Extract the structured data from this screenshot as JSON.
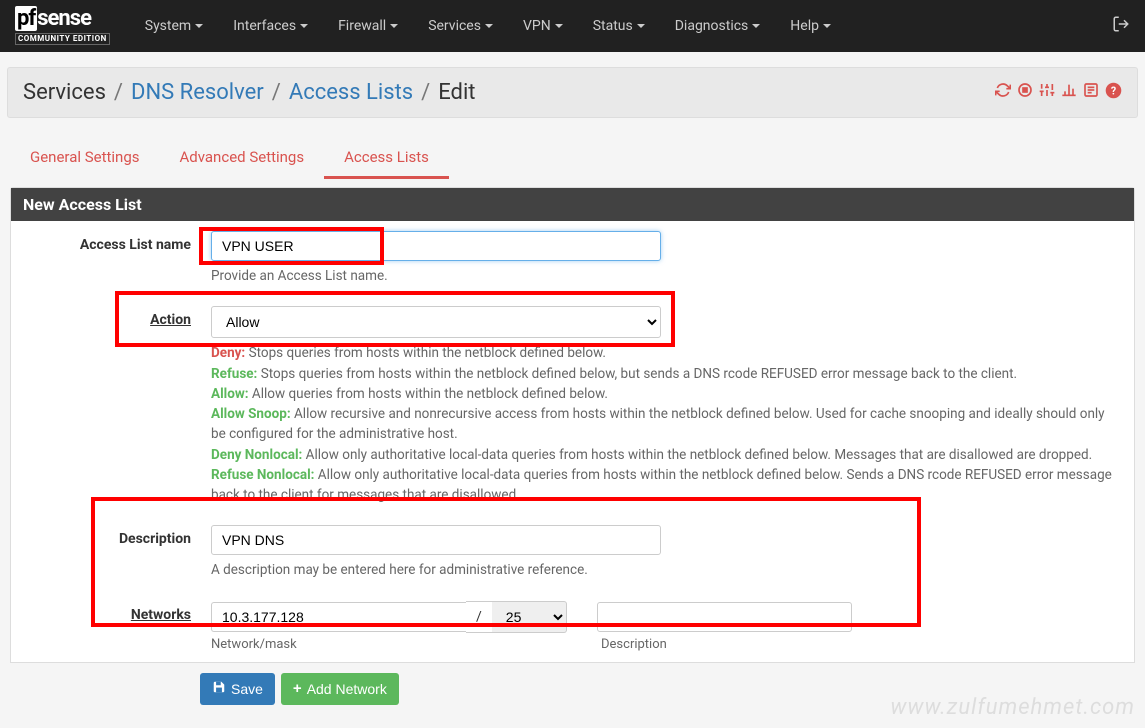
{
  "navbar": {
    "brand_main_pf": "pf",
    "brand_main_sense": "sense",
    "brand_sub": "COMMUNITY EDITION",
    "items": [
      "System",
      "Interfaces",
      "Firewall",
      "Services",
      "VPN",
      "Status",
      "Diagnostics",
      "Help"
    ]
  },
  "breadcrumb": {
    "services": "Services",
    "resolver": "DNS Resolver",
    "acl": "Access Lists",
    "edit": "Edit"
  },
  "tabs": {
    "general": "General Settings",
    "advanced": "Advanced Settings",
    "acl": "Access Lists"
  },
  "panel_title": "New Access List",
  "labels": {
    "name": "Access List name",
    "action": "Action",
    "description": "Description",
    "networks": "Networks",
    "network_mask": "Network/mask",
    "net_description": "Description"
  },
  "values": {
    "name": "VPN USER",
    "action": "Allow",
    "description": "VPN DNS",
    "network": "10.3.177.128",
    "mask": "25"
  },
  "help": {
    "name": "Provide an Access List name.",
    "deny_k": "Deny:",
    "deny_t": " Stops queries from hosts within the netblock defined below.",
    "refuse_k": "Refuse:",
    "refuse_t": " Stops queries from hosts within the netblock defined below, but sends a DNS rcode REFUSED error message back to the client.",
    "allow_k": "Allow:",
    "allow_t": " Allow queries from hosts within the netblock defined below.",
    "snoop_k": "Allow Snoop:",
    "snoop_t": " Allow recursive and nonrecursive access from hosts within the netblock defined below. Used for cache snooping and ideally should only be configured for the administrative host.",
    "denynl_k": "Deny Nonlocal:",
    "denynl_t": " Allow only authoritative local-data queries from hosts within the netblock defined below. Messages that are disallowed are dropped.",
    "refusenl_k": "Refuse Nonlocal:",
    "refusenl_t": " Allow only authoritative local-data queries from hosts within the netblock defined below. Sends a DNS rcode REFUSED error message back to the client for messages that are disallowed.",
    "description": "A description may be entered here for administrative reference."
  },
  "buttons": {
    "save": "Save",
    "add": "Add Network"
  },
  "watermark": "www.zulfumehmet.com"
}
